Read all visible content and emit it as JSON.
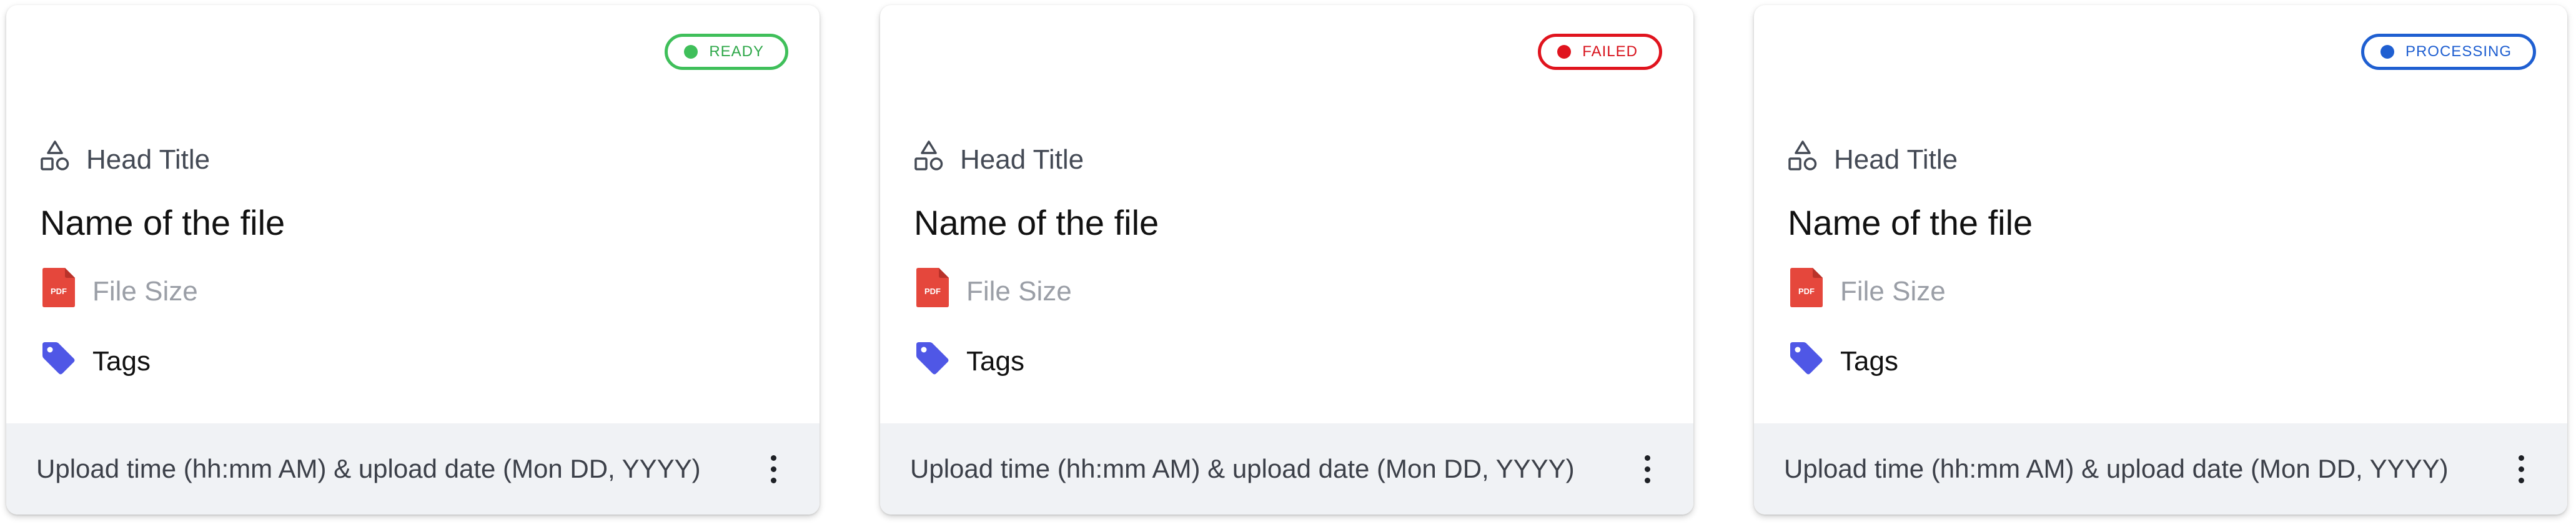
{
  "cards": [
    {
      "status": {
        "label": "READY",
        "color": "#3fbf5a",
        "text_color": "#2fa84a"
      },
      "head_title": "Head Title",
      "file_name": "Name of the file",
      "file_size": "File Size",
      "file_icon_label": "PDF",
      "tags": "Tags",
      "upload_info": "Upload time (hh:mm AM) & upload date (Mon DD, YYYY)"
    },
    {
      "status": {
        "label": "FAILED",
        "color": "#e0141e",
        "text_color": "#d8141e"
      },
      "head_title": "Head Title",
      "file_name": "Name of the file",
      "file_size": "File Size",
      "file_icon_label": "PDF",
      "tags": "Tags",
      "upload_info": "Upload time (hh:mm AM) & upload date (Mon DD, YYYY)"
    },
    {
      "status": {
        "label": "PROCESSING",
        "color": "#1f5fd1",
        "text_color": "#1f5fd1"
      },
      "head_title": "Head Title",
      "file_name": "Name of the file",
      "file_size": "File Size",
      "file_icon_label": "PDF",
      "tags": "Tags",
      "upload_info": "Upload time (hh:mm AM) & upload date (Mon DD, YYYY)"
    }
  ],
  "colors": {
    "pdf_icon": "#e5473c",
    "tag_icon": "#4f57e6",
    "shapes_icon": "#444a55",
    "footer_bg": "#f0f2f5"
  },
  "icons": {
    "head_title": "shapes-icon",
    "file_type": "pdf-file-icon",
    "tags": "tag-icon",
    "menu": "more-vertical-icon"
  }
}
